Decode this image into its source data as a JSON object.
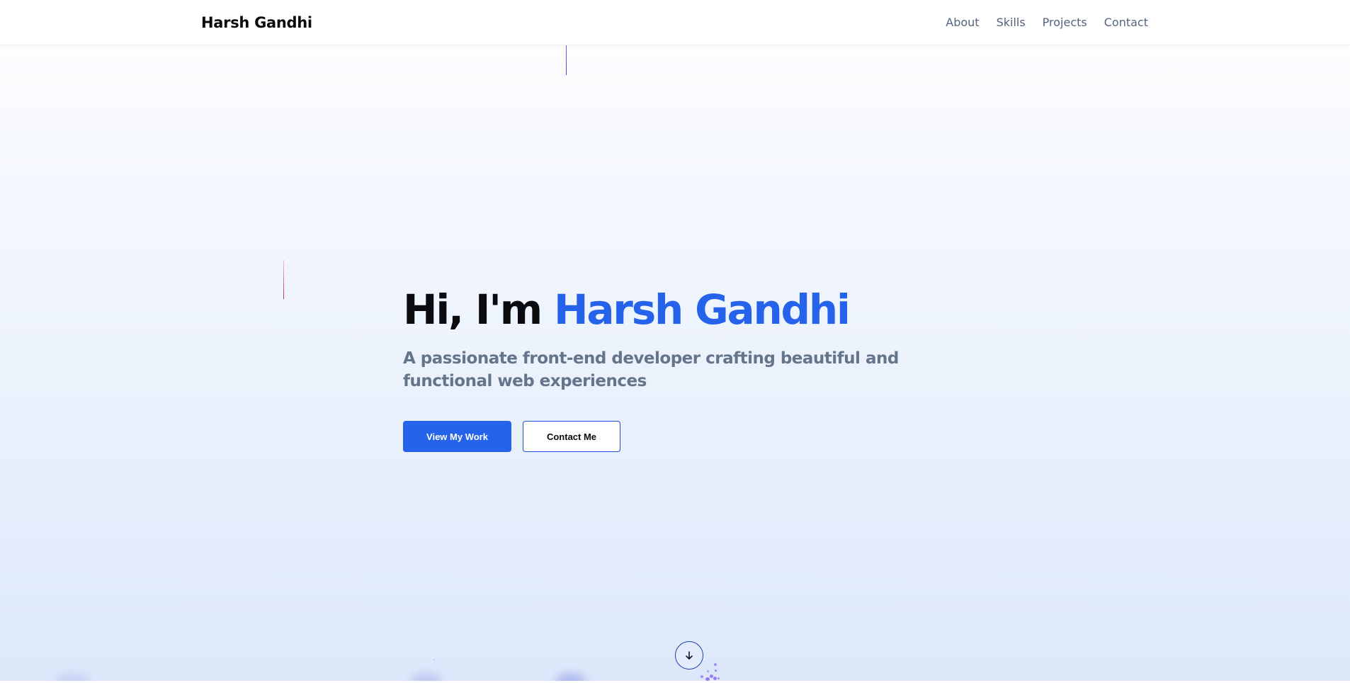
{
  "nav": {
    "brand": "Harsh Gandhi",
    "links": [
      "About",
      "Skills",
      "Projects",
      "Contact"
    ]
  },
  "hero": {
    "greeting": "Hi, I'm",
    "name": "Harsh Gandhi",
    "subtitle": "A passionate front-end developer crafting beautiful and functional web experiences",
    "primary_button": "View My Work",
    "secondary_button": "Contact Me"
  },
  "icons": {
    "scroll": "arrow-down-icon"
  },
  "colors": {
    "accent": "#2563eb",
    "text_dark": "#0a0a0f",
    "text_muted": "#64748b",
    "nav_text": "#53647c"
  }
}
